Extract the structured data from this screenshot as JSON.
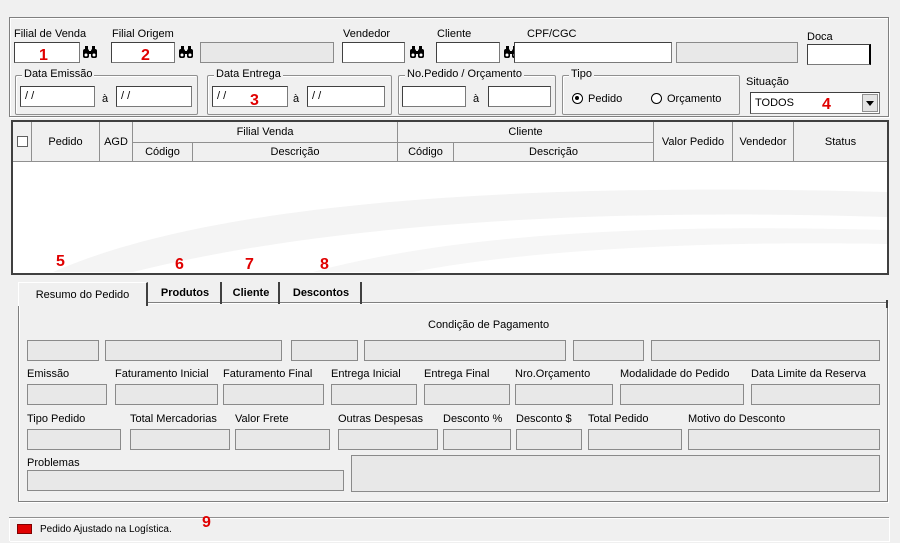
{
  "filters": {
    "filial_venda_label": "Filial de Venda",
    "filial_origem_label": "Filial Origem",
    "vendedor_label": "Vendedor",
    "cliente_label": "Cliente",
    "cpf_cgc_label": "CPF/CGC",
    "doca_label": "Doca",
    "data_emissao_title": "Data Emissão",
    "data_emissao_from": " / /",
    "data_emissao_to": " / /",
    "data_entrega_title": "Data Entrega",
    "data_entrega_from": " / /",
    "data_entrega_to": " / /",
    "a_label": "à",
    "pedido_title": "No.Pedido / Orçamento",
    "tipo_title": "Tipo",
    "tipo_pedido": "Pedido",
    "tipo_orcamento": "Orçamento",
    "situacao_label": "Situação",
    "situacao_value": "TODOS"
  },
  "grid": {
    "col_pedido": "Pedido",
    "col_agd": "AGD",
    "group_filial": "Filial Venda",
    "group_cliente": "Cliente",
    "col_codigo": "Código",
    "col_descricao": "Descrição",
    "col_valor": "Valor Pedido",
    "col_vendedor": "Vendedor",
    "col_status": "Status"
  },
  "tabs": [
    "Resumo do Pedido",
    "Produtos",
    "Cliente",
    "Descontos"
  ],
  "resumo": {
    "condicao_label": "Condição de Pagamento",
    "row2_labels": [
      "Emissão",
      "Faturamento Inicial",
      "Faturamento Final",
      "Entrega Inicial",
      "Entrega Final",
      "Nro.Orçamento",
      "Modalidade do Pedido",
      "Data Limite da Reserva"
    ],
    "row3_labels": [
      "Tipo Pedido",
      "Total Mercadorias",
      "Valor Frete",
      "Outras Despesas",
      "Desconto %",
      "Desconto $",
      "Total Pedido",
      "Motivo do Desconto"
    ],
    "problemas_label": "Problemas"
  },
  "legend": {
    "text": "Pedido Ajustado na Logística.",
    "color": "#e00000"
  },
  "markers": [
    "1",
    "2",
    "3",
    "4",
    "5",
    "6",
    "7",
    "8",
    "9"
  ],
  "colors": {
    "accent_red": "#e00000",
    "window_bg": "#f0f0f0"
  }
}
